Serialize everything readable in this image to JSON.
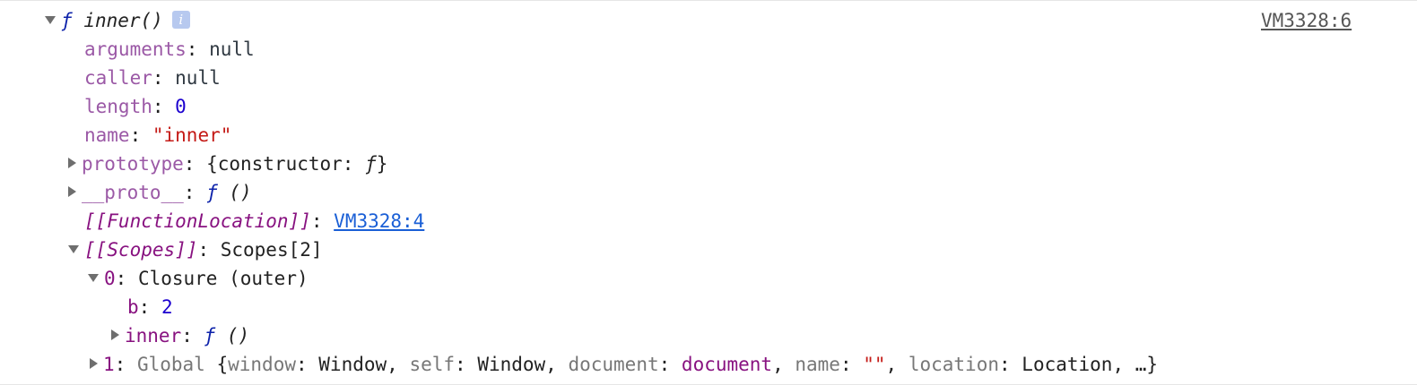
{
  "header": {
    "f_symbol": "ƒ",
    "function_signature": "inner()",
    "info_icon": "i",
    "source_link": "VM3328:6"
  },
  "properties": {
    "arguments": {
      "key": "arguments",
      "value": "null"
    },
    "caller": {
      "key": "caller",
      "value": "null"
    },
    "length": {
      "key": "length",
      "value": "0"
    },
    "name": {
      "key": "name",
      "value": "\"inner\""
    },
    "prototype": {
      "key": "prototype",
      "value_prefix": "{constructor: ",
      "value_f": "ƒ",
      "value_suffix": "}"
    },
    "proto": {
      "key": "__proto__",
      "value_f": "ƒ",
      "value_suffix": " ()"
    },
    "function_location": {
      "key": "[[FunctionLocation]]",
      "value": "VM3328:4"
    },
    "scopes": {
      "key": "[[Scopes]]",
      "value": "Scopes[2]"
    }
  },
  "scope0": {
    "index": "0",
    "label": "Closure (outer)",
    "b": {
      "key": "b",
      "value": "2"
    },
    "inner": {
      "key": "inner",
      "value_f": "ƒ",
      "value_suffix": " ()"
    }
  },
  "scope1": {
    "index": "1",
    "label": "Global",
    "open": "{",
    "k1": "window",
    "v1": "Window",
    "k2": "self",
    "v2": "Window",
    "k3": "document",
    "v3": "document",
    "k4": "name",
    "v4": "\"\"",
    "k5": "location",
    "v5": "Location",
    "tail": ", …}"
  },
  "colors": {
    "property": "#9b59a6",
    "internal_property": "#881280",
    "number": "#1c00cf",
    "string": "#c41a16",
    "link": "#1a5fd6",
    "keyword_f": "#0d22aa"
  }
}
